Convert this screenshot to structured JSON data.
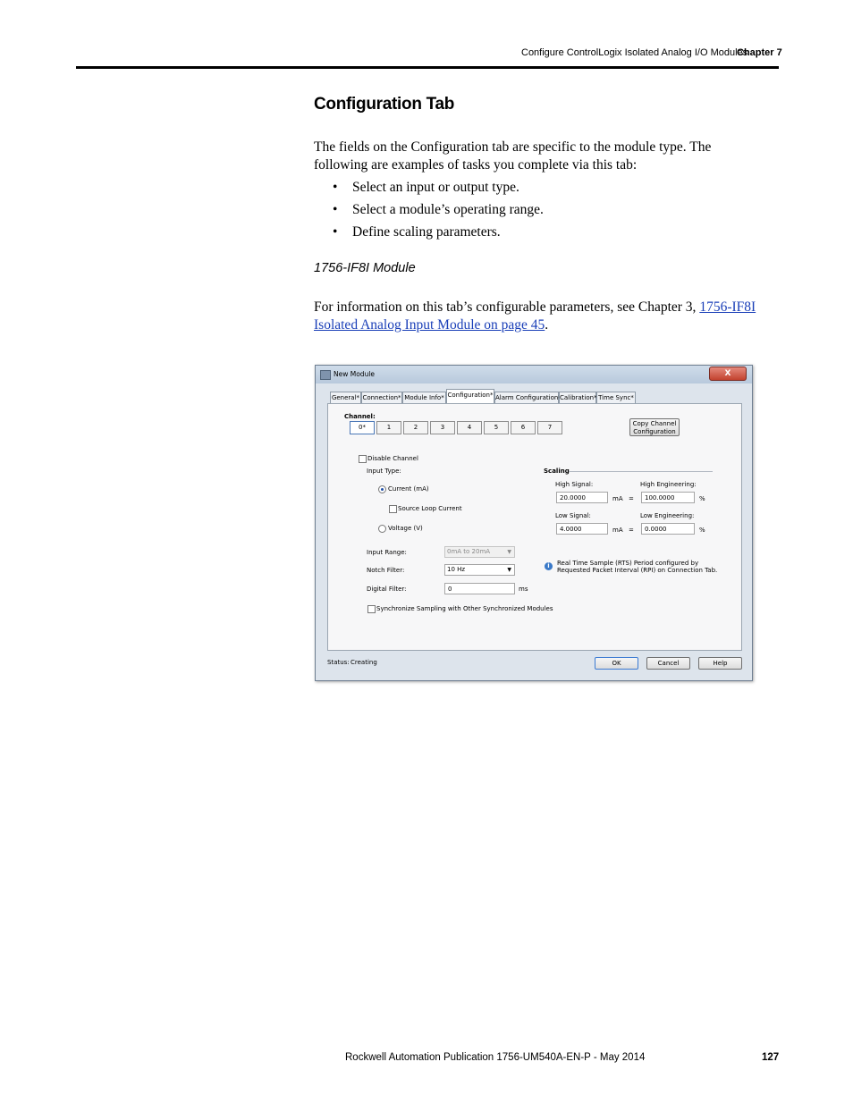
{
  "header": {
    "running_title": "Configure ControlLogix Isolated Analog I/O Modules",
    "chapter": "Chapter 7"
  },
  "section": {
    "title": "Configuration Tab",
    "intro_line1": "The fields on the Configuration tab are specific to the module type. The",
    "intro_line2": "following are examples of tasks you complete via this tab:",
    "bullets": [
      "Select an input or output type.",
      "Select a module’s operating range.",
      "Define scaling parameters."
    ],
    "figure_caption": "1756-IF8I Module",
    "ref_prefix": "For information on this tab’s configurable parameters, see Chapter 3,",
    "ref_link_line1": "1756-IF8I",
    "ref_link_line2": "Isolated Analog Input Module on page 45",
    "ref_suffix": "."
  },
  "dialog": {
    "title": "New Module",
    "close_label": "X",
    "tabs": [
      "General*",
      "Connection*",
      "Module Info*",
      "Configuration*",
      "Alarm Configuration*",
      "Calibration*",
      "Time Sync*"
    ],
    "active_tab": "Configuration*",
    "channel_label": "Channel:",
    "channels": [
      "0*",
      "1",
      "2",
      "3",
      "4",
      "5",
      "6",
      "7"
    ],
    "copy_btn_line1": "Copy Channel",
    "copy_btn_line2": "Configuration",
    "disable_channel": "Disable Channel",
    "input_type_label": "Input Type:",
    "current_option": "Current (mA)",
    "source_loop": "Source Loop Current",
    "voltage_option": "Voltage (V)",
    "input_range_label": "Input Range:",
    "input_range_value": "0mA to 20mA",
    "notch_filter_label": "Notch Filter:",
    "notch_filter_value": "10 Hz",
    "digital_filter_label": "Digital Filter:",
    "digital_filter_value": "0",
    "digital_filter_unit": "ms",
    "sync_sampling": "Synchronize Sampling with Other Synchronized Modules",
    "scaling_label": "Scaling",
    "high_signal_label": "High Signal:",
    "high_signal_value": "20.0000",
    "low_signal_label": "Low Signal:",
    "low_signal_value": "4.0000",
    "signal_unit": "mA",
    "equals": "=",
    "high_eng_label": "High Engineering:",
    "high_eng_value": "100.0000",
    "low_eng_label": "Low Engineering:",
    "low_eng_value": "0.0000",
    "eng_unit": "%",
    "info_line1": "Real Time Sample (RTS) Period configured by",
    "info_line2": "Requested Packet Interval (RPI) on Connection Tab.",
    "status_label": "Status:",
    "status_value": "Creating",
    "ok_label": "OK",
    "cancel_label": "Cancel",
    "help_label": "Help"
  },
  "footer": {
    "publication": "Rockwell Automation Publication 1756-UM540A-EN-P - May 2014",
    "page_number": "127"
  }
}
